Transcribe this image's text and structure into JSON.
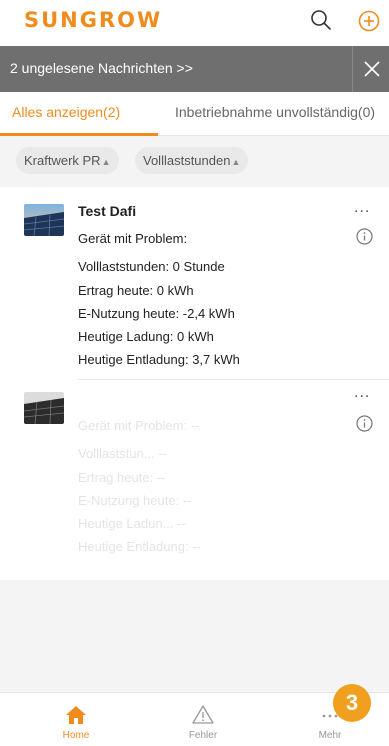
{
  "header": {
    "logo": "SUNGROW",
    "search_icon": "search-icon",
    "add_icon": "add-circle-icon"
  },
  "notice": {
    "text": "2 ungelesene Nachrichten >>",
    "close_icon": "close-icon"
  },
  "tabs": [
    {
      "label": "Alles anzeigen(2)",
      "active": true
    },
    {
      "label": "Inbetriebnahme unvollständig(0)",
      "active": false
    }
  ],
  "filters": [
    {
      "label": "Kraftwerk PR",
      "icon": "sort-icon"
    },
    {
      "label": "Volllaststunden",
      "icon": "sort-icon"
    }
  ],
  "plants": [
    {
      "name": "Test Dafi",
      "lines": [
        "Gerät mit Problem:",
        "Volllaststunden: 0 Stunde",
        "Ertrag heute: 0 kWh",
        "E-Nutzung heute: -2,4 kWh",
        "Heutige Ladung: 0 kWh",
        "Heutige Entladung: 3,7 kWh"
      ],
      "more_label": "...",
      "info_icon": "info-icon"
    },
    {
      "name": "",
      "lines": [
        "Gerät mit Problem: --",
        "Volllaststun... --",
        "Ertrag heute: --",
        "E-Nutzung heute: --",
        "Heutige Ladun... --",
        "Heutige Entladung: --"
      ],
      "more_label": "...",
      "info_icon": "info-icon"
    }
  ],
  "tabbar": [
    {
      "label": "Home",
      "icon": "home-icon",
      "active": true
    },
    {
      "label": "Fehler",
      "icon": "warning-icon",
      "active": false
    },
    {
      "label": "Mehr",
      "icon": "more-icon",
      "active": false
    }
  ],
  "step_badge": "3",
  "colors": {
    "accent": "#f08c1e",
    "notice_bg": "#6f6f6f",
    "badge": "#f0a01e"
  }
}
